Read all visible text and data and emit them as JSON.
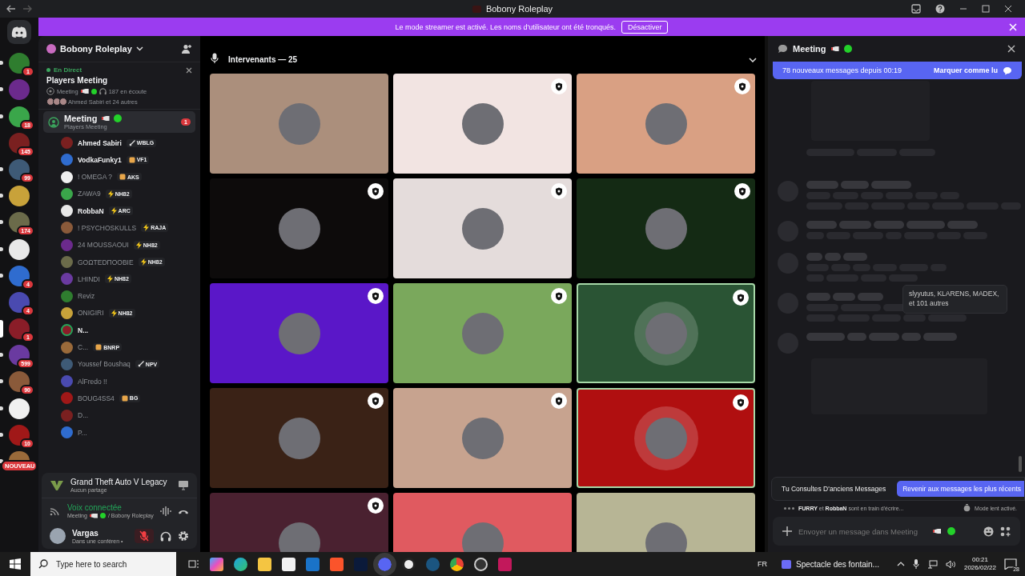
{
  "window": {
    "title": "Bobony Roleplay"
  },
  "banner": {
    "text": "Le mode streamer est activé. Les noms d'utilisateur ont été tronqués.",
    "button": "Désactiver"
  },
  "servers": [
    {
      "badge": "1",
      "unread": true,
      "selected": false
    },
    {
      "unread": true,
      "selected": false
    },
    {
      "badge": "18",
      "unread": true,
      "selected": false
    },
    {
      "badge": "145",
      "unread": false,
      "selected": false
    },
    {
      "badge": "99",
      "unread": true,
      "selected": false
    },
    {
      "unread": true,
      "selected": false
    },
    {
      "badge": "174",
      "unread": true,
      "selected": false
    },
    {
      "unread": true,
      "selected": false
    },
    {
      "badge": "4",
      "unread": true,
      "selected": false
    },
    {
      "badge": "4",
      "unread": false,
      "selected": false
    },
    {
      "badge": "1",
      "selected": true
    },
    {
      "badge": "599",
      "unread": true,
      "selected": false
    },
    {
      "badge": "90",
      "unread": true,
      "selected": false
    },
    {
      "unread": true,
      "selected": false
    },
    {
      "badge": "10",
      "unread": true,
      "selected": false
    },
    {
      "badge": "NOUVEAU",
      "unread": true,
      "selected": false
    }
  ],
  "sidebar": {
    "server": "Bobony Roleplay",
    "live": {
      "label": "En Direct",
      "title": "Players Meeting",
      "channel": "Meeting",
      "listeners": "187 en écoute",
      "people": "Ahmed Sabiri et 24 autres"
    },
    "channel": {
      "name": "Meeting",
      "topic": "Players Meeting",
      "badge": "1",
      "selected": true
    },
    "members": [
      {
        "name": "Ahmed Sabiri",
        "bold": true,
        "speaking": false,
        "tag": {
          "text": "WBLG",
          "kind": "sword"
        }
      },
      {
        "name": "VodkaFunky1",
        "bold": true,
        "speaking": false,
        "tag": {
          "text": "VF1",
          "kind": "badge"
        }
      },
      {
        "name": "! OMEGA ?",
        "bold": false,
        "speaking": false,
        "tag": {
          "text": "AKS",
          "kind": "badge"
        }
      },
      {
        "name": "ZAWA9",
        "bold": false,
        "speaking": false,
        "tag": {
          "text": "NH82",
          "kind": "bolt"
        }
      },
      {
        "name": "RobbaN",
        "bold": true,
        "speaking": false,
        "tag": {
          "text": "ARC",
          "kind": "bolt"
        }
      },
      {
        "name": "! PSYCHOSKULLS",
        "bold": false,
        "speaking": false,
        "tag": {
          "text": "RAJA",
          "kind": "bolt"
        }
      },
      {
        "name": "24 MOUSSAOUI",
        "bold": false,
        "speaking": false,
        "tag": {
          "text": "NH82",
          "kind": "bolt"
        }
      },
      {
        "name": "GOΩTEDΠOOBIE",
        "bold": false,
        "speaking": false,
        "tag": {
          "text": "NH82",
          "kind": "bolt"
        }
      },
      {
        "name": "LHINDI",
        "bold": false,
        "speaking": false,
        "tag": {
          "text": "NH82",
          "kind": "bolt"
        }
      },
      {
        "name": "Reviz",
        "bold": false,
        "speaking": false
      },
      {
        "name": "ONIGIRI",
        "bold": false,
        "speaking": false,
        "tag": {
          "text": "NH82",
          "kind": "bolt"
        }
      },
      {
        "name": "N...",
        "bold": true,
        "speaking": true
      },
      {
        "name": "C...",
        "bold": false,
        "speaking": false,
        "tag": {
          "text": "BNRP",
          "kind": "badge"
        }
      },
      {
        "name": "Youssef Boushaq",
        "bold": false,
        "speaking": false,
        "tag": {
          "text": "NPV",
          "kind": "sword"
        }
      },
      {
        "name": "AlFredo !!",
        "bold": false,
        "speaking": false
      },
      {
        "name": "BOUG4SS4",
        "bold": false,
        "speaking": false,
        "tag": {
          "text": "BG",
          "kind": "badge"
        }
      },
      {
        "name": "D...",
        "bold": false,
        "speaking": false
      },
      {
        "name": "P...",
        "bold": false,
        "speaking": false
      }
    ],
    "activity": {
      "game": "Grand Theft Auto V Legacy",
      "sharing": "Aucun partage"
    },
    "voice": {
      "status": "Voix connectée",
      "channel": "Meeting",
      "server": "/ Bobony Roleplay"
    },
    "user": {
      "name": "Vargas",
      "status": "Dans une conféren •",
      "muted": true
    }
  },
  "stage": {
    "title": "Intervenants — 25",
    "tiles": [
      {
        "color": "#ab8f7c",
        "shield": false,
        "speaking": false
      },
      {
        "color": "#f2e4e2",
        "shield": true,
        "speaking": false
      },
      {
        "color": "#d9a083",
        "shield": true,
        "speaking": false
      },
      {
        "color": "#0d0b0b",
        "shield": true,
        "speaking": false
      },
      {
        "color": "#e4dcdb",
        "shield": true,
        "speaking": false
      },
      {
        "color": "#142a14",
        "shield": true,
        "speaking": false
      },
      {
        "color": "#5a17c8",
        "shield": true,
        "speaking": false
      },
      {
        "color": "#7aa85c",
        "shield": true,
        "speaking": false
      },
      {
        "color": "#2a5434",
        "shield": true,
        "speaking": true
      },
      {
        "color": "#3a2216",
        "shield": true,
        "speaking": false
      },
      {
        "color": "#c7a38f",
        "shield": true,
        "speaking": false
      },
      {
        "color": "#b00f10",
        "shield": true,
        "speaking": true
      },
      {
        "color": "#4a2130",
        "shield": true,
        "speaking": false
      },
      {
        "color": "#e05a60",
        "shield": false,
        "speaking": false
      },
      {
        "color": "#b7b595",
        "shield": false,
        "speaking": false
      }
    ]
  },
  "chat": {
    "channel": "Meeting",
    "new_messages": "78 nouveaux messages depuis 00:19",
    "mark_read": "Marquer comme lu",
    "tooltip": "slyyutus, KLARENS, MADEX, et 101 autres",
    "old_notice": "Tu Consultes D'anciens Messages",
    "jump_button": "Revenir aux messages les plus récents",
    "typing": "**FURRY** et **RobbaN** sont en train d'écrire...",
    "slow_mode": "Mode lent activé.",
    "input": {
      "placeholder": "Envoyer un message dans Meeting"
    }
  },
  "taskbar": {
    "search": {
      "placeholder": "Type here to search"
    },
    "language": "FR",
    "media": "Spectacle des fontain...",
    "time": "00:21",
    "date": "2026/02/22",
    "notifications": "28"
  }
}
